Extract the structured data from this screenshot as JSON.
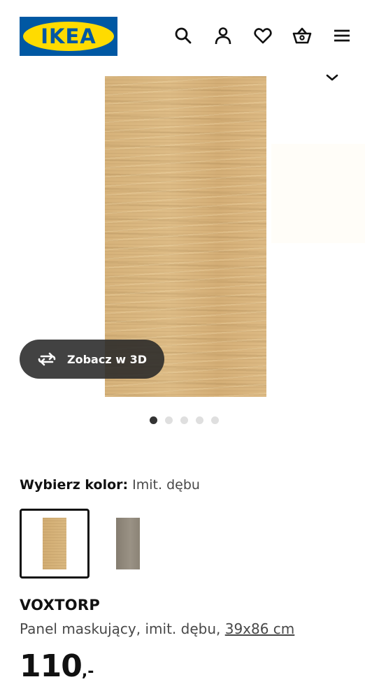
{
  "header": {
    "logo_text": "IKEA",
    "brand_colors": {
      "blue": "#0058a3",
      "yellow": "#ffdb00"
    },
    "icons": [
      "search-icon",
      "user-icon",
      "heart-icon",
      "basket-icon",
      "menu-icon"
    ]
  },
  "gallery": {
    "view_3d_label": "Zobacz w 3D",
    "dot_count": 5,
    "active_dot": 1
  },
  "color_picker": {
    "label": "Wybierz kolor:",
    "selected_value": "Imit. dębu",
    "options": [
      "oak-effect",
      "grey-beige"
    ]
  },
  "product": {
    "name": "VOXTORP",
    "description": "Panel maskujący, imit. dębu,",
    "size_link": "39x86 cm",
    "price_integer": "110",
    "price_suffix": ",-"
  }
}
